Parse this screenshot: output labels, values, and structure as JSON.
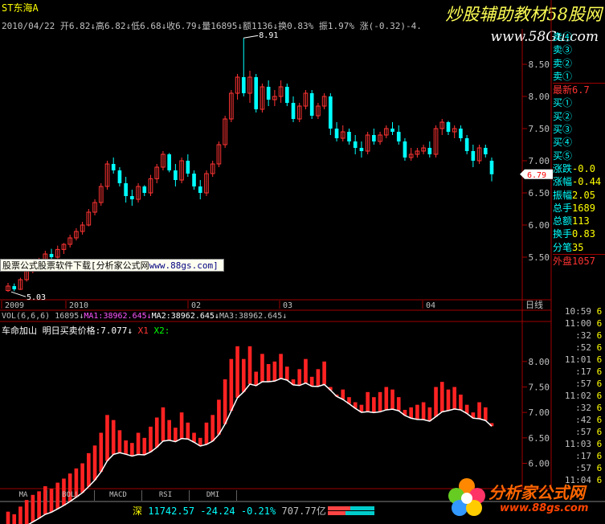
{
  "header": {
    "name": "ST东海A",
    "line2": "2010/04/22 开6.82↓高6.82↓低6.68↓收6.79↓量16895↓额1136↓换0.83% 振1.97% 涨(-0.32)-4."
  },
  "banner": {
    "title": "炒股辅助教材58股网",
    "url": "www.58Gu.com"
  },
  "right_panel": {
    "rows": [
      {
        "label": "卖④",
        "value": "",
        "color": "#00ffff"
      },
      {
        "label": "卖③",
        "value": "",
        "color": "#00ffff"
      },
      {
        "label": "卖②",
        "value": "",
        "color": "#00ffff"
      },
      {
        "label": "卖①",
        "value": "",
        "color": "#00ffff"
      },
      {
        "label": "最新",
        "value": "6.7",
        "color": "#ff3333"
      },
      {
        "label": "买①",
        "value": "",
        "color": "#00ffff"
      },
      {
        "label": "买②",
        "value": "",
        "color": "#00ffff"
      },
      {
        "label": "买③",
        "value": "",
        "color": "#00ffff"
      },
      {
        "label": "买④",
        "value": "",
        "color": "#00ffff"
      },
      {
        "label": "买⑤",
        "value": "",
        "color": "#00ffff"
      },
      {
        "label": "涨跌",
        "value": "-0.0",
        "color": "#00ffff"
      },
      {
        "label": "涨幅",
        "value": "-0.44",
        "color": "#00ffff"
      },
      {
        "label": "振幅",
        "value": "2.05",
        "color": "#00ffff"
      },
      {
        "label": "总手",
        "value": "1689",
        "color": "#00ffff"
      },
      {
        "label": "总额",
        "value": "113",
        "color": "#00ffff"
      },
      {
        "label": "换手",
        "value": "0.83",
        "color": "#00ffff"
      },
      {
        "label": "分笔",
        "value": "35",
        "color": "#00ffff"
      },
      {
        "label": "外盘",
        "value": "1057",
        "color": "#ff3333"
      }
    ],
    "times": [
      "10:59",
      "11:00",
      ":32",
      ":52",
      "11:01",
      ":17",
      ":57",
      "11:02",
      ":32",
      ":42",
      ":57",
      "11:03",
      ":17",
      ":57",
      "11:04"
    ],
    "time_vals": [
      "6",
      "6",
      "6",
      "6",
      "6",
      "6",
      "6",
      "6",
      "6",
      "6",
      "6",
      "6",
      "6",
      "6",
      "6"
    ]
  },
  "ad": {
    "text": "股票公式股票软件下载[分析家公式网",
    "site": "www.88gs.com]"
  },
  "chart_data": [
    {
      "type": "candlestick",
      "y_ticks": [
        5.5,
        6.0,
        6.5,
        7.0,
        7.5,
        8.0,
        8.5
      ],
      "ylim": [
        4.85,
        9.05
      ],
      "x_labels": [
        "2009",
        "2010",
        "02",
        "03",
        "04"
      ],
      "period_label": "日线",
      "max_label": "8.91",
      "min_label": "5.03",
      "last_label": "6.79",
      "candles": [
        [
          4.98,
          5.1,
          4.96,
          5.05
        ],
        [
          5.05,
          5.09,
          4.97,
          5.0
        ],
        [
          5.0,
          5.18,
          4.99,
          5.15
        ],
        [
          5.15,
          5.3,
          5.12,
          5.28
        ],
        [
          5.28,
          5.42,
          5.25,
          5.38
        ],
        [
          5.38,
          5.49,
          5.3,
          5.45
        ],
        [
          5.45,
          5.6,
          5.4,
          5.55
        ],
        [
          5.55,
          5.63,
          5.46,
          5.5
        ],
        [
          5.5,
          5.68,
          5.48,
          5.62
        ],
        [
          5.62,
          5.72,
          5.55,
          5.7
        ],
        [
          5.7,
          5.85,
          5.65,
          5.8
        ],
        [
          5.8,
          5.95,
          5.76,
          5.9
        ],
        [
          5.9,
          6.05,
          5.85,
          6.0
        ],
        [
          6.0,
          6.25,
          5.98,
          6.2
        ],
        [
          6.2,
          6.4,
          6.15,
          6.35
        ],
        [
          6.35,
          6.65,
          6.3,
          6.6
        ],
        [
          6.6,
          7.0,
          6.55,
          6.95
        ],
        [
          6.95,
          7.05,
          6.8,
          6.85
        ],
        [
          6.85,
          6.9,
          6.6,
          6.65
        ],
        [
          6.65,
          6.75,
          6.35,
          6.45
        ],
        [
          6.45,
          6.55,
          6.3,
          6.4
        ],
        [
          6.4,
          6.65,
          6.35,
          6.6
        ],
        [
          6.6,
          6.62,
          6.45,
          6.5
        ],
        [
          6.5,
          6.78,
          6.45,
          6.72
        ],
        [
          6.72,
          6.95,
          6.65,
          6.9
        ],
        [
          6.9,
          7.15,
          6.85,
          7.1
        ],
        [
          7.1,
          7.12,
          6.82,
          6.85
        ],
        [
          6.85,
          6.95,
          6.6,
          6.7
        ],
        [
          6.7,
          7.05,
          6.65,
          7.0
        ],
        [
          7.0,
          7.1,
          6.75,
          6.8
        ],
        [
          6.8,
          6.85,
          6.55,
          6.6
        ],
        [
          6.6,
          6.7,
          6.4,
          6.5
        ],
        [
          6.5,
          6.85,
          6.45,
          6.8
        ],
        [
          6.8,
          7.0,
          6.75,
          6.95
        ],
        [
          6.95,
          7.3,
          6.9,
          7.25
        ],
        [
          7.25,
          7.7,
          7.2,
          7.65
        ],
        [
          7.65,
          8.1,
          7.6,
          8.05
        ],
        [
          8.05,
          8.35,
          7.95,
          8.3
        ],
        [
          8.3,
          8.91,
          8.0,
          8.05
        ],
        [
          8.05,
          8.4,
          7.9,
          8.3
        ],
        [
          8.3,
          8.35,
          7.75,
          7.8
        ],
        [
          7.8,
          8.2,
          7.75,
          8.15
        ],
        [
          8.15,
          8.25,
          7.85,
          7.95
        ],
        [
          7.95,
          8.1,
          7.85,
          8.0
        ],
        [
          8.0,
          8.25,
          7.9,
          8.15
        ],
        [
          8.15,
          8.2,
          7.85,
          7.9
        ],
        [
          7.9,
          8.0,
          7.6,
          7.65
        ],
        [
          7.65,
          7.9,
          7.6,
          7.85
        ],
        [
          7.85,
          8.1,
          7.8,
          8.05
        ],
        [
          8.05,
          8.1,
          7.65,
          7.7
        ],
        [
          7.7,
          7.9,
          7.65,
          7.85
        ],
        [
          7.85,
          8.05,
          7.8,
          8.0
        ],
        [
          8.0,
          8.05,
          7.4,
          7.5
        ],
        [
          7.5,
          7.6,
          7.3,
          7.35
        ],
        [
          7.35,
          7.55,
          7.3,
          7.45
        ],
        [
          7.45,
          7.5,
          7.25,
          7.3
        ],
        [
          7.3,
          7.4,
          7.1,
          7.2
        ],
        [
          7.2,
          7.3,
          7.05,
          7.15
        ],
        [
          7.15,
          7.45,
          7.1,
          7.4
        ],
        [
          7.4,
          7.5,
          7.25,
          7.3
        ],
        [
          7.3,
          7.45,
          7.25,
          7.4
        ],
        [
          7.4,
          7.55,
          7.35,
          7.5
        ],
        [
          7.5,
          7.6,
          7.4,
          7.45
        ],
        [
          7.45,
          7.55,
          7.25,
          7.3
        ],
        [
          7.3,
          7.35,
          7.0,
          7.05
        ],
        [
          7.05,
          7.2,
          7.0,
          7.1
        ],
        [
          7.1,
          7.2,
          7.05,
          7.15
        ],
        [
          7.15,
          7.25,
          7.1,
          7.2
        ],
        [
          7.2,
          7.3,
          7.05,
          7.1
        ],
        [
          7.1,
          7.55,
          7.05,
          7.5
        ],
        [
          7.5,
          7.65,
          7.4,
          7.6
        ],
        [
          7.6,
          7.62,
          7.4,
          7.45
        ],
        [
          7.45,
          7.55,
          7.35,
          7.5
        ],
        [
          7.5,
          7.55,
          7.3,
          7.35
        ],
        [
          7.35,
          7.4,
          7.1,
          7.15
        ],
        [
          7.15,
          7.25,
          6.9,
          7.0
        ],
        [
          7.0,
          7.25,
          6.95,
          7.2
        ],
        [
          7.2,
          7.25,
          7.05,
          7.1
        ],
        [
          7.0,
          7.05,
          6.68,
          6.79
        ]
      ]
    },
    {
      "type": "line",
      "name": "明日买卖价格",
      "legend": "VOL(6,6,6) 16895↓MA1:38962.645↓MA2:38962.645↓MA3:38962.645↓",
      "legend_parts": [
        "VOL(6,6,6) 16895↓",
        "MA1:38962.645↓",
        "MA2:38962.645↓",
        "MA3:38962.645↓"
      ],
      "indicator_title": "车命加山  明日买卖价格:7.077↓",
      "x1_label": "X1",
      "x2_label": "X2:",
      "y_ticks": [
        6.0,
        6.5,
        7.0,
        7.5,
        8.0
      ],
      "ylim": [
        5.55,
        8.55
      ]
    }
  ],
  "tabs": [
    "MA",
    "BOLL",
    "MACD",
    "RSI",
    "DMI"
  ],
  "status": {
    "market": "深",
    "index": "11742.57",
    "change": "-24.24",
    "pct": "-0.21%",
    "amount": "707.77亿"
  },
  "logo": {
    "text": "分析家公式网",
    "url": "www.88gs.com"
  }
}
